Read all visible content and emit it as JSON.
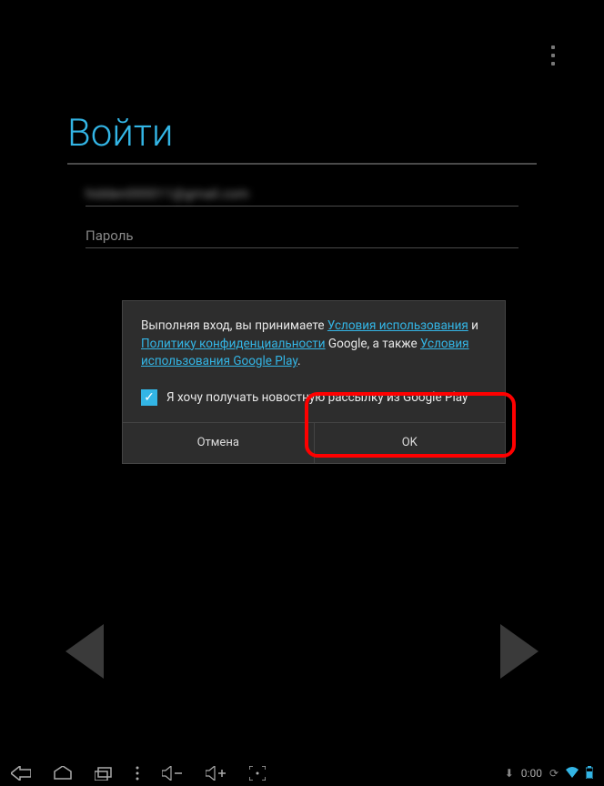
{
  "login": {
    "title": "Войти",
    "email_value": "hidden000011@gmail.com",
    "password_placeholder": "Пароль"
  },
  "dialog": {
    "text_prefix": "Выполняя вход, вы принимаете ",
    "link_tos": "Условия использования",
    "text_and": " и ",
    "link_privacy": "Политику конфиденциальности",
    "text_google": " Google, а также ",
    "link_play_tos": "Условия использования Google Play",
    "text_period": ".",
    "checkbox_label": "Я хочу получать новостную рассылку из Google Play",
    "cancel_label": "Отмена",
    "ok_label": "OK"
  },
  "status": {
    "time": "0:00"
  }
}
